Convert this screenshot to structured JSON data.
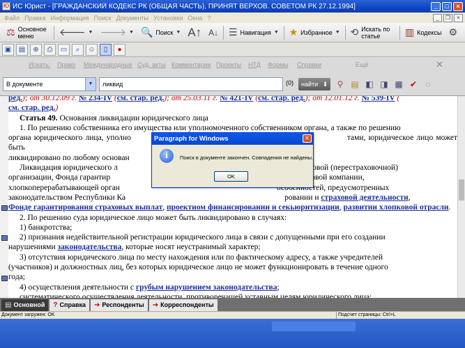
{
  "window": {
    "title": "ИС Юрист - [ГРАЖДАНСКИЙ КОДЕКС РК (ОБЩАЯ ЧАСТЬ), ПРИНЯТ ВЕРХОВ. СОВЕТОМ РК 27.12.1994]"
  },
  "menu": {
    "items": [
      "Файл",
      "Правка",
      "Информация",
      "Поиск",
      "Документы",
      "Установки",
      "Окна",
      "?"
    ]
  },
  "toolbar": {
    "main_menu": "Основное меню",
    "search": "Поиск",
    "navigation": "Навигация",
    "favorites": "Избранное",
    "search_by_article": "Искать по статье",
    "codes": "Кодексы"
  },
  "search_panel": {
    "prefix": "Искать:",
    "links": [
      "Право",
      "Международные",
      "Суд. акты",
      "Комментарии",
      "Проекты",
      "НТД",
      "Формы",
      "Справки"
    ],
    "more": "Ещё",
    "scope": "В документе",
    "query": "ликвид",
    "count": "(0)",
    "find_button": "найти"
  },
  "document": {
    "line1": {
      "a": "ред.",
      "b": "); от 30.12.09 г. ",
      "c": "№ 234-IV",
      "d": " (",
      "e": "см. стар. ред.",
      "f": "); от 25.03.11 г. ",
      "g": "№ 421-IV",
      "h": " (",
      "i": "см. стар. ред.",
      "j": "); от 12.01.12 г. ",
      "k": "№ 539-IV",
      "l": " ("
    },
    "line2": {
      "a": "см. стар. ред.",
      "b": ")"
    },
    "article_label": "Статья 49.",
    "article_title": " Основания ликвидации юридического лица",
    "p1": [
      "1. По решению собственника его имущества или уполномоченного собственником органа, а также по решению",
      "органа юридического лица, уполно",
      "тами, юридическое лицо может быть",
      "ликвидировано по любому основан"
    ],
    "p2": [
      "Ликвидация юридического л",
      "нда, страховой (перестраховочной)",
      "организации, Фонда гарантир",
      "альной финансовой компании,",
      "хлопкоперерабатывающей орган",
      "особенностей, предусмотренных",
      "законодательством Республики Ка",
      "ровании и "
    ],
    "p2_link1": "страховой деятельности",
    "p2_link2": "Фонде гарантирования страховых выплат",
    "p2_link3": "проектном финансировании и секьюритизации",
    "p2_link4": "развитии хлопковой отрасли",
    "p3": "2. По решению суда юридическое лицо может быть ликвидировано в случаях:",
    "p4": "1) банкротства;",
    "p5a": "2) признания недействительной регистрации юридического лица в связи с допущенными при его создании",
    "p5b": "нарушениями ",
    "p5_link": "законодательства",
    "p5c": ", которые носят неустранимый характер;",
    "p6a": "3) отсутствия юридического лица по месту нахождения или по фактическому адресу, а также учредителей",
    "p6b": "(участников) и должностных лиц, без которых юридическое лицо не может функционировать в течение одного",
    "p6c": "года;",
    "p7a": "4) осуществления деятельности с ",
    "p7_link": "грубым нарушением законодательства",
    "p7b": ";",
    "p8": "систематического осуществления деятельности, противоречащей уставным целям юридического лица;"
  },
  "tabs": [
    "Основной",
    "Справка",
    "Респонденты",
    "Корреспонденты"
  ],
  "status": {
    "left": "Документ загружен: OK",
    "right": "Подсчет страницы: Ctrl+L"
  },
  "dialog": {
    "title": "Paragraph for Windows",
    "message": "Поиск в документе закончен. Совпадения не найдены.",
    "ok": "OK"
  }
}
